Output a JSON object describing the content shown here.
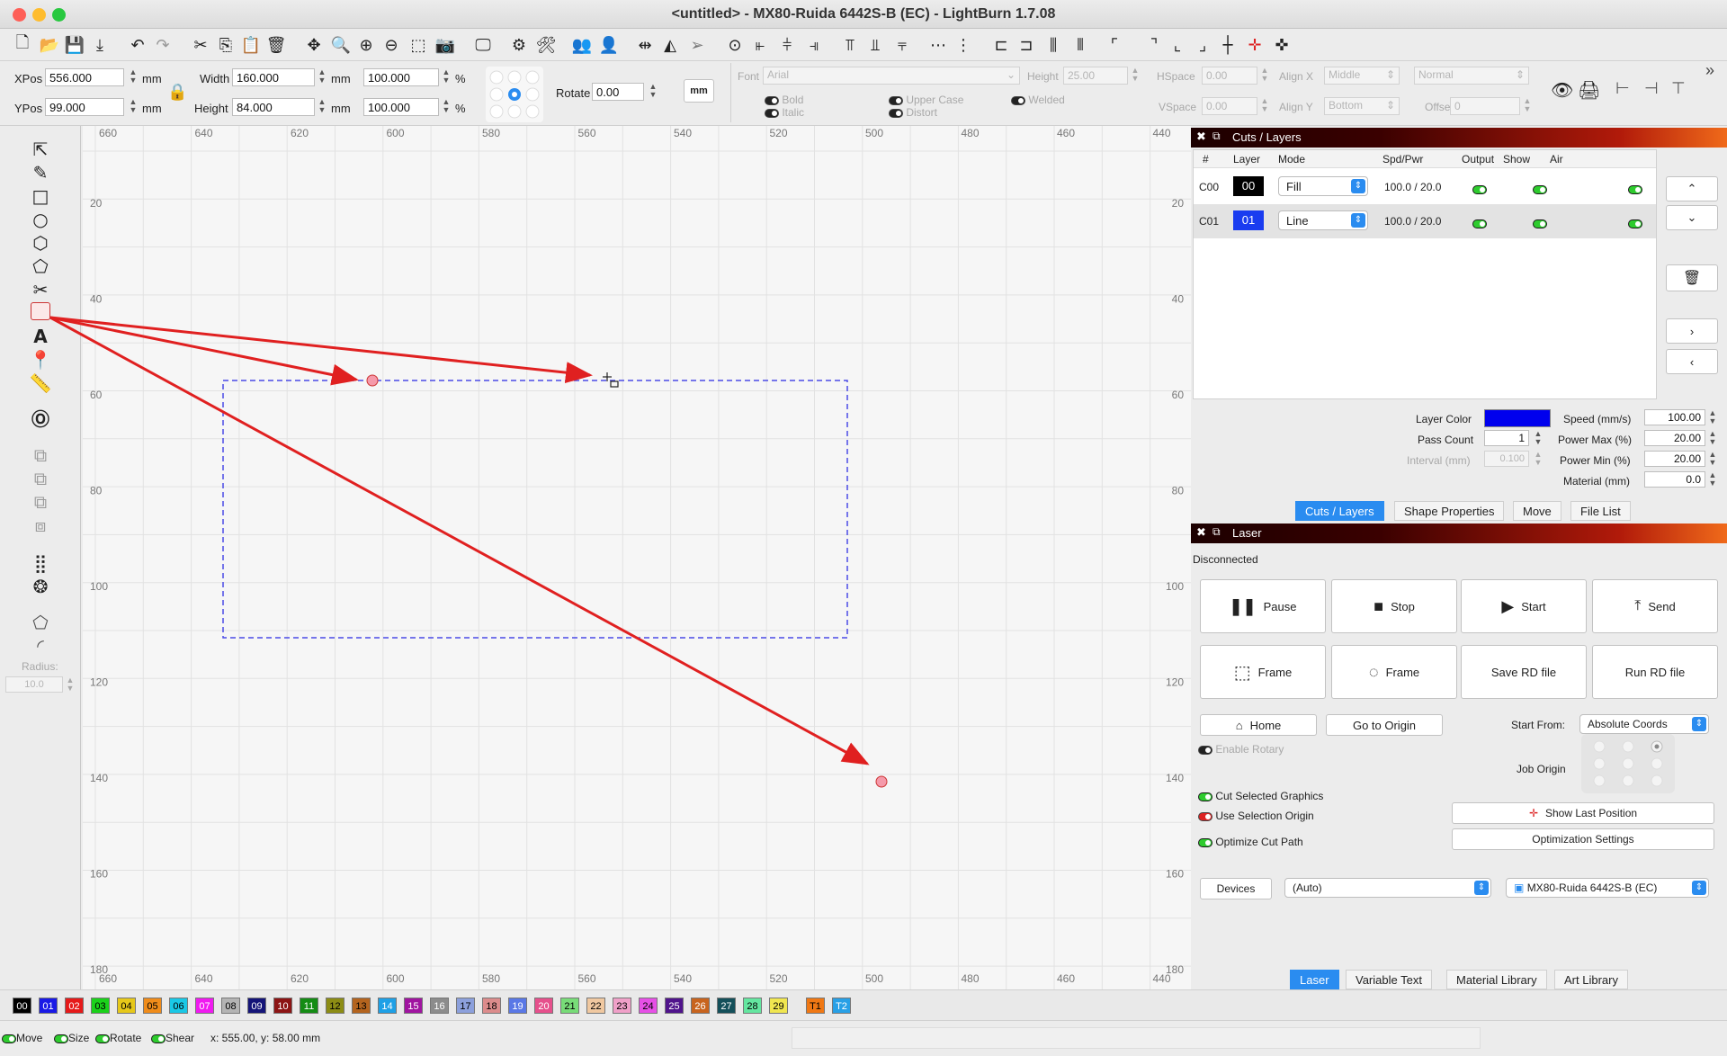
{
  "window": {
    "title": "<untitled> - MX80-Ruida 6442S-B (EC) - LightBurn 1.7.08"
  },
  "props": {
    "xpos_label": "XPos",
    "xpos": "556.000",
    "ypos_label": "YPos",
    "ypos": "99.000",
    "unit": "mm",
    "width_label": "Width",
    "width": "160.000",
    "height_label": "Height",
    "height": "84.000",
    "scale_w": "100.000",
    "scale_h": "100.000",
    "pct": "%",
    "rotate_label": "Rotate",
    "rotate": "0.00",
    "mm_button": "mm"
  },
  "text": {
    "font_label": "Font",
    "font": "Arial",
    "height_label": "Height",
    "height": "25.00",
    "hspace_label": "HSpace",
    "hspace": "0.00",
    "vspace_label": "VSpace",
    "vspace": "0.00",
    "alignx_label": "Align X",
    "alignx": "Middle",
    "aligny_label": "Align Y",
    "aligny": "Bottom",
    "normal": "Normal",
    "offset_label": "Offset",
    "offset": "0",
    "bold": "Bold",
    "italic": "Italic",
    "upper": "Upper Case",
    "distort": "Distort",
    "welded": "Welded"
  },
  "lefttools": {
    "radius_label": "Radius:",
    "radius": "10.0"
  },
  "ruler": {
    "top": [
      "660",
      "640",
      "620",
      "600",
      "580",
      "560",
      "540",
      "520",
      "500",
      "480",
      "460",
      "440"
    ],
    "left": [
      "20",
      "40",
      "60",
      "80",
      "100",
      "120",
      "140",
      "160",
      "180"
    ]
  },
  "cuts": {
    "title": "Cuts / Layers",
    "headers": [
      "#",
      "Layer",
      "Mode",
      "Spd/Pwr",
      "Output",
      "Show",
      "Air"
    ],
    "rows": [
      {
        "id": "C00",
        "layer": "00",
        "mode": "Fill",
        "spdpwr": "100.0 / 20.0",
        "color": "#000000"
      },
      {
        "id": "C01",
        "layer": "01",
        "mode": "Line",
        "spdpwr": "100.0 / 20.0",
        "color": "#1a3cf0"
      }
    ],
    "layer_color_label": "Layer Color",
    "layer_color": "#0000ee",
    "pass_label": "Pass Count",
    "pass": "1",
    "interval_label": "Interval (mm)",
    "interval": "0.100",
    "speed_label": "Speed (mm/s)",
    "speed": "100.00",
    "pmax_label": "Power Max (%)",
    "pmax": "20.00",
    "pmin_label": "Power Min (%)",
    "pmin": "20.00",
    "material_label": "Material (mm)",
    "material": "0.0",
    "tabs": [
      "Cuts / Layers",
      "Shape Properties",
      "Move",
      "File List"
    ]
  },
  "laser": {
    "title": "Laser",
    "status": "Disconnected",
    "pause": "Pause",
    "stop": "Stop",
    "start": "Start",
    "send": "Send",
    "frame1": "Frame",
    "frame2": "Frame",
    "save_rd": "Save RD file",
    "run_rd": "Run RD file",
    "home": "Home",
    "goto": "Go to Origin",
    "start_from_label": "Start From:",
    "start_from": "Absolute Coords",
    "rotary": "Enable Rotary",
    "job_origin": "Job Origin",
    "cut_sel": "Cut Selected Graphics",
    "use_sel": "Use Selection Origin",
    "opt_path": "Optimize Cut Path",
    "show_last": "Show Last Position",
    "opt_settings": "Optimization Settings",
    "devices": "Devices",
    "auto": "(Auto)",
    "device": "MX80-Ruida 6442S-B (EC)",
    "tabs": [
      "Laser",
      "Variable Text",
      "Material Library",
      "Art Library"
    ]
  },
  "palette": [
    {
      "l": "00",
      "c": "#000000",
      "t": "#fff"
    },
    {
      "l": "01",
      "c": "#1a1ae6",
      "t": "#fff"
    },
    {
      "l": "02",
      "c": "#e61a1a",
      "t": "#fff"
    },
    {
      "l": "03",
      "c": "#1ad21a",
      "t": "#000"
    },
    {
      "l": "04",
      "c": "#e6c81a",
      "t": "#000"
    },
    {
      "l": "05",
      "c": "#f08c1a",
      "t": "#000"
    },
    {
      "l": "06",
      "c": "#1ac8e6",
      "t": "#000"
    },
    {
      "l": "07",
      "c": "#f01af0",
      "t": "#fff"
    },
    {
      "l": "08",
      "c": "#b4b4b4",
      "t": "#000"
    },
    {
      "l": "09",
      "c": "#141478",
      "t": "#fff"
    },
    {
      "l": "10",
      "c": "#8c1414",
      "t": "#fff"
    },
    {
      "l": "11",
      "c": "#148c14",
      "t": "#fff"
    },
    {
      "l": "12",
      "c": "#8c8c14",
      "t": "#000"
    },
    {
      "l": "13",
      "c": "#b4641e",
      "t": "#000"
    },
    {
      "l": "14",
      "c": "#1ea0e6",
      "t": "#fff"
    },
    {
      "l": "15",
      "c": "#a014a0",
      "t": "#fff"
    },
    {
      "l": "16",
      "c": "#8c8c8c",
      "t": "#fff"
    },
    {
      "l": "17",
      "c": "#8ca0dc",
      "t": "#000"
    },
    {
      "l": "18",
      "c": "#dc8c8c",
      "t": "#000"
    },
    {
      "l": "19",
      "c": "#5a78e6",
      "t": "#fff"
    },
    {
      "l": "20",
      "c": "#e6508c",
      "t": "#fff"
    },
    {
      "l": "21",
      "c": "#78dc78",
      "t": "#000"
    },
    {
      "l": "22",
      "c": "#f0c8a0",
      "t": "#000"
    },
    {
      "l": "23",
      "c": "#f0a0c8",
      "t": "#000"
    },
    {
      "l": "24",
      "c": "#e650e6",
      "t": "#000"
    },
    {
      "l": "25",
      "c": "#50148c",
      "t": "#fff"
    },
    {
      "l": "26",
      "c": "#c8641e",
      "t": "#fff"
    },
    {
      "l": "27",
      "c": "#14505a",
      "t": "#fff"
    },
    {
      "l": "28",
      "c": "#64e6a0",
      "t": "#000"
    },
    {
      "l": "29",
      "c": "#f0e650",
      "t": "#000"
    },
    {
      "l": "T1",
      "c": "#f07814",
      "t": "#000"
    },
    {
      "l": "T2",
      "c": "#28a0e6",
      "t": "#fff"
    }
  ],
  "status": {
    "move": "Move",
    "size": "Size",
    "rotate": "Rotate",
    "shear": "Shear",
    "coords": "x: 555.00, y: 58.00 mm"
  }
}
